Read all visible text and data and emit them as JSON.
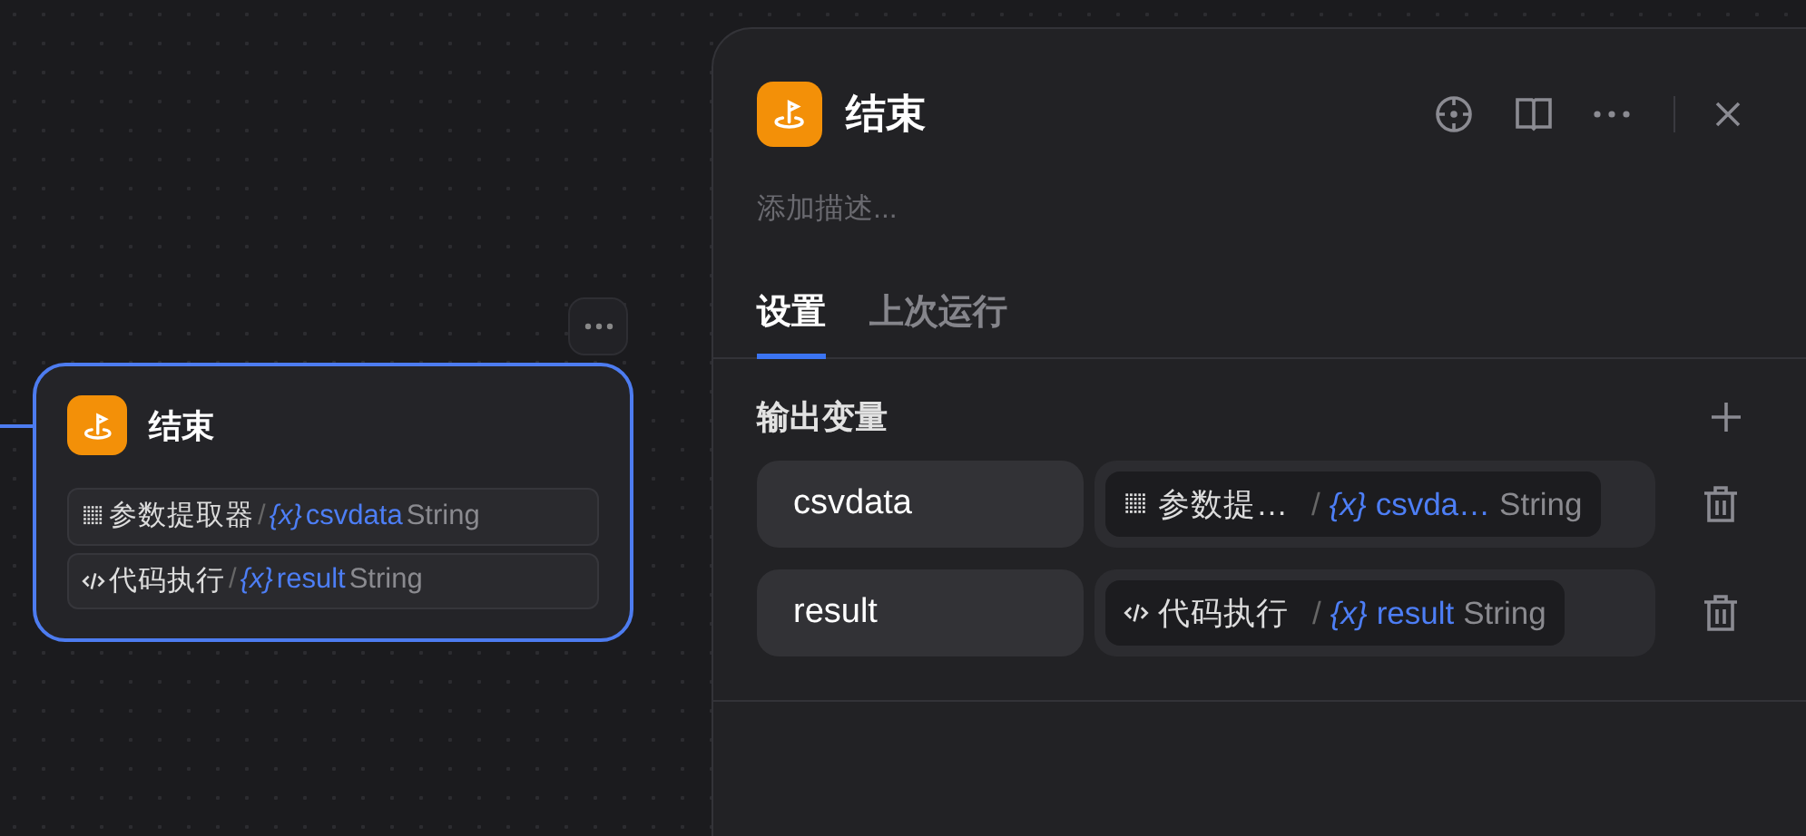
{
  "node": {
    "title": "结束",
    "selected": true,
    "variables": [
      {
        "kind": "extractor",
        "source": "参数提取器",
        "separator": "/",
        "var_mark": "{x}",
        "name": "csvdata",
        "type": "String"
      },
      {
        "kind": "code",
        "source": "代码执行",
        "separator": "/",
        "var_mark": "{x}",
        "name": "result",
        "type": "String"
      }
    ]
  },
  "panel": {
    "title": "结束",
    "description": {
      "placeholder": "添加描述..."
    },
    "tabs": [
      {
        "label": "设置",
        "selected": true
      },
      {
        "label": "上次运行",
        "selected": false
      }
    ],
    "section_title": "输出变量",
    "outputs": [
      {
        "name": "csvdata",
        "ref": {
          "kind": "extractor",
          "source": "参数提…",
          "separator": "/",
          "var_mark": "{x}",
          "name": "csvda…",
          "type": "String"
        }
      },
      {
        "name": "result",
        "ref": {
          "kind": "code",
          "source": "代码执行",
          "separator": "/",
          "var_mark": "{x}",
          "name": "result",
          "type": "String"
        }
      }
    ]
  }
}
